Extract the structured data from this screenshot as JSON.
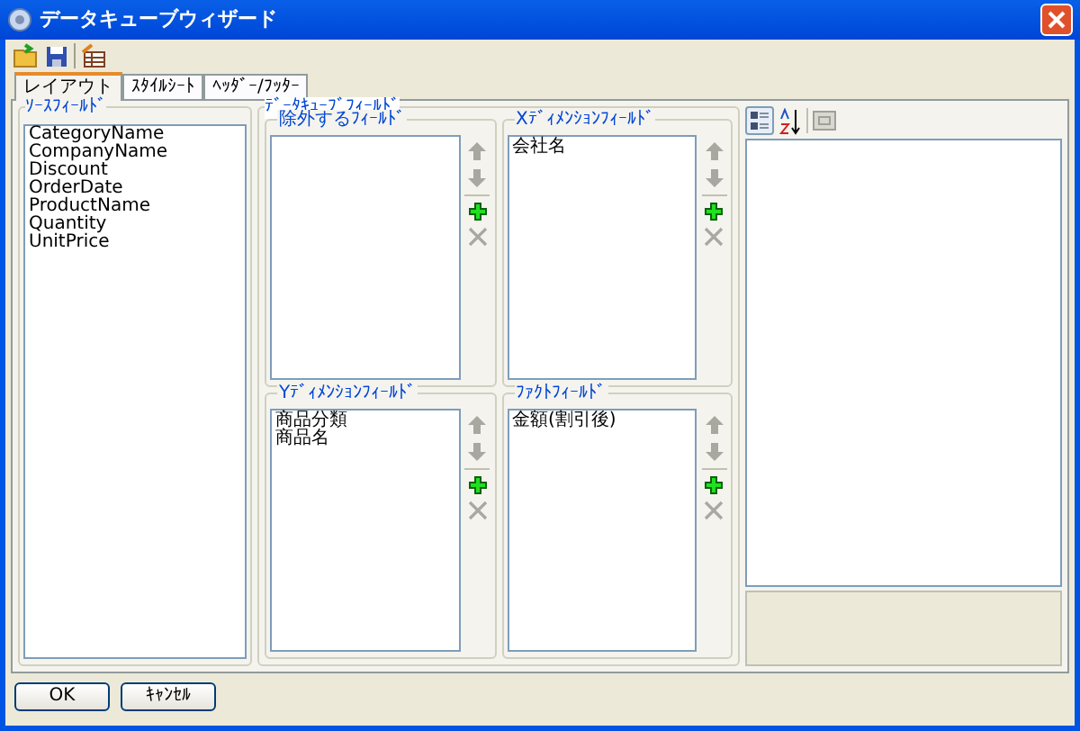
{
  "window": {
    "title": "データキューブウィザード"
  },
  "tabs": [
    {
      "label": "レイアウト",
      "selected": true
    },
    {
      "label": "ｽﾀｲﾙｼｰﾄ",
      "selected": false
    },
    {
      "label": "ﾍｯﾀﾞｰ/ﾌｯﾀｰ",
      "selected": false
    }
  ],
  "source_fields": {
    "title": "ｿｰｽﾌｨｰﾙﾄﾞ",
    "items": [
      "CategoryName",
      "CompanyName",
      "Discount",
      "OrderDate",
      "ProductName",
      "Quantity",
      "UnitPrice"
    ]
  },
  "datacube_fields": {
    "title": "ﾃﾞｰﾀｷｭｰﾌﾞﾌｨｰﾙﾄﾞ",
    "panels": [
      {
        "title": "除外するﾌｨｰﾙﾄﾞ"
      },
      {
        "title": "Xﾃﾞｨﾒﾝｼｮﾝﾌｨｰﾙﾄﾞ",
        "items": [
          "会社名"
        ]
      },
      {
        "title": "Yﾃﾞｨﾒﾝｼｮﾝﾌｨｰﾙﾄﾞ",
        "items": [
          "商品分類",
          "商品名"
        ]
      },
      {
        "title": "ﾌｧｸﾄﾌｨｰﾙﾄﾞ",
        "items": [
          "金額(割引後)"
        ]
      }
    ]
  },
  "buttons": [
    "OK",
    "ｷｬﾝｾﾙ"
  ]
}
